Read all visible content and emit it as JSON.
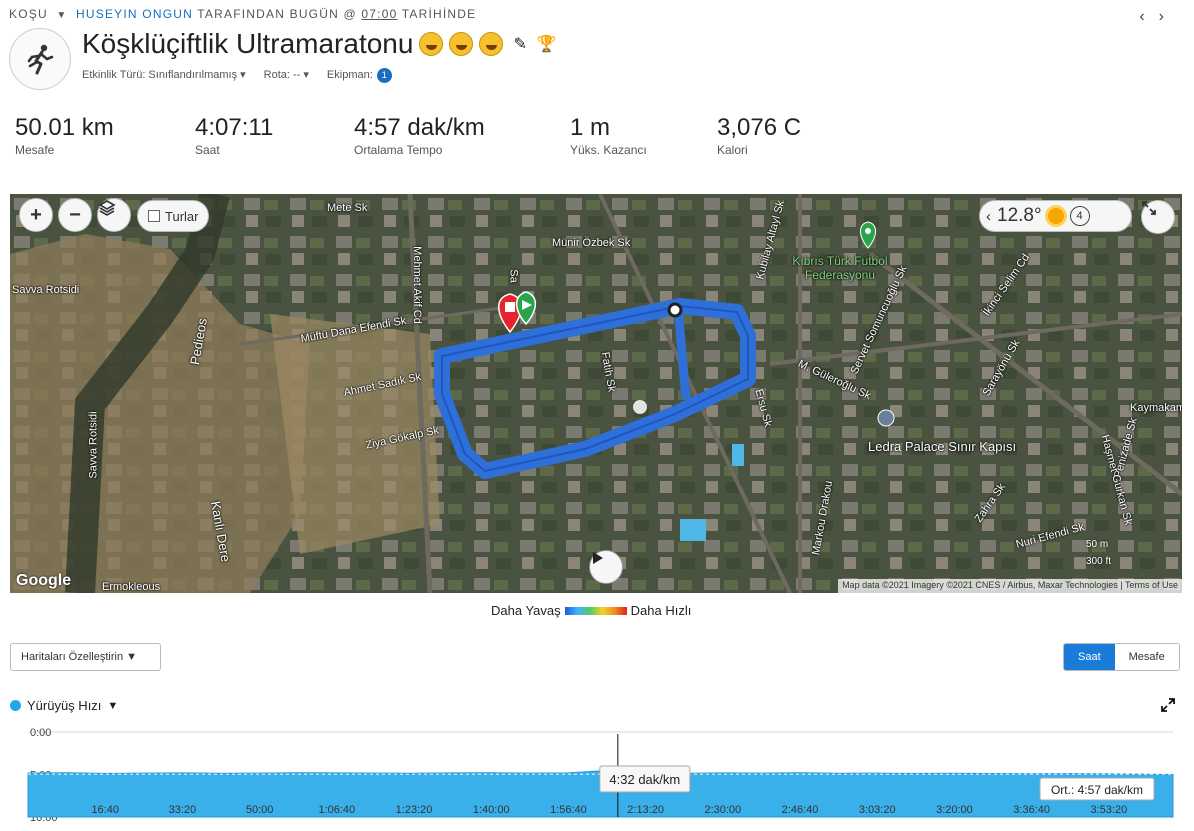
{
  "breadcrumb": {
    "activity_type": "KOŞU",
    "user": "HUSEYIN ONGUN",
    "middle": "TARAFINDAN BUGÜN @",
    "time": "07:00",
    "suffix": "TARİHİNDE"
  },
  "header": {
    "title": "Köşklüçiftlik Ultramaratonu",
    "activity_type_label": "Etkinlik Türü: Sınıflandırılmamış",
    "route_label": "Rota: --",
    "equipment_label": "Ekipman:",
    "equipment_count": "1"
  },
  "stats": [
    {
      "value": "50.01 km",
      "label": "Mesafe"
    },
    {
      "value": "4:07:11",
      "label": "Saat"
    },
    {
      "value": "4:57 dak/km",
      "label": "Ortalama Tempo"
    },
    {
      "value": "1 m",
      "label": "Yüks. Kazancı"
    },
    {
      "value": "3,076 C",
      "label": "Kalori"
    }
  ],
  "map": {
    "zoom_in": "+",
    "zoom_out": "−",
    "laps_label": "Turlar",
    "temperature": "12.8°",
    "wind": "4",
    "logo": "Google",
    "attribution": "Map data ©2021 Imagery ©2021 CNES / Airbus, Maxar Technologies  |  Terms of Use",
    "scale_m": "50 m",
    "scale_ft": "300 ft",
    "labels": {
      "mete": "Mete Sk",
      "munir": "Münir Özbek Sk",
      "savva1": "Savva Rotsidi",
      "savva2": "Savva Rotsidi",
      "pedieos": "Pedieos",
      "mehmet": "Mehmet Akif Cd",
      "mufti": "Müftü Dana Efendi Sk",
      "ahmet": "Ahmet Sadık Sk",
      "ziya": "Ziya Gökalp Sk",
      "fatih": "Fatih Sk",
      "ersu": "Ersu Sk",
      "kanli": "Kanlı Dere",
      "ermo": "Ermokleous",
      "federasyon": "Kıbrıs Türk Futbol Federasyonu",
      "ledra": "Ledra Palace Sınır Kapısı",
      "kubilay": "Kubilay Altayl Sk",
      "servet": "Servet Somuncuoğlu Sk",
      "ikinci": "İkinci Selim Cd",
      "sarayonu": "Sarayönü Sk",
      "gulero": "M. Güleroğlu Sk",
      "kaymakam": "Kaymakam",
      "penizade": "Penizade Sk",
      "hasmet": "Haşmet Gürkan Sk",
      "zahra": "Zahra Sk",
      "nuri": "Nuri Efendi Sk",
      "markou": "Markou Drakou",
      "sa": "Sa"
    }
  },
  "legend": {
    "slow": "Daha Yavaş",
    "fast": "Daha Hızlı"
  },
  "controls": {
    "customize": "Haritaları Özelleştirin",
    "time_toggle": "Saat",
    "distance_toggle": "Mesafe"
  },
  "chart_data": {
    "type": "area",
    "title": "Yürüyüş Hızı",
    "y_tick_labels": [
      "0:00",
      "5:00",
      "10:00"
    ],
    "ylim_seconds_per_km": [
      0,
      600
    ],
    "y_inverted": true,
    "x_tick_labels": [
      "16:40",
      "33:20",
      "50:00",
      "1:06:40",
      "1:23:20",
      "1:40:00",
      "1:56:40",
      "2:13:20",
      "2:30:00",
      "2:46:40",
      "3:03:20",
      "3:20:00",
      "3:36:40",
      "3:53:20"
    ],
    "x_tick_seconds": [
      1000,
      2000,
      3000,
      4000,
      5000,
      6000,
      7000,
      8000,
      9000,
      10000,
      11000,
      12000,
      13000,
      14000
    ],
    "duration_seconds": 14831,
    "tooltip_label": "4:32 dak/km",
    "tooltip_seconds": 7640,
    "average_label": "Ort.: 4:57 dak/km",
    "average_pace_seconds": 297,
    "pace_samples": {
      "x": [
        0,
        500,
        1000,
        1500,
        2000,
        2500,
        3000,
        3500,
        4000,
        4500,
        5000,
        5500,
        6000,
        6500,
        7000,
        7500,
        8000,
        8500,
        9000,
        9500,
        10000,
        10500,
        11000,
        11500,
        12000,
        12500,
        13000,
        13500,
        14000,
        14500,
        14831
      ],
      "y": [
        290,
        288,
        292,
        290,
        289,
        291,
        290,
        288,
        289,
        290,
        291,
        289,
        288,
        290,
        289,
        272,
        288,
        292,
        289,
        290,
        288,
        291,
        290,
        292,
        291,
        293,
        295,
        294,
        296,
        298,
        300
      ]
    },
    "colors": {
      "fill": "#3ab0ea",
      "line": "#2196d8"
    }
  }
}
